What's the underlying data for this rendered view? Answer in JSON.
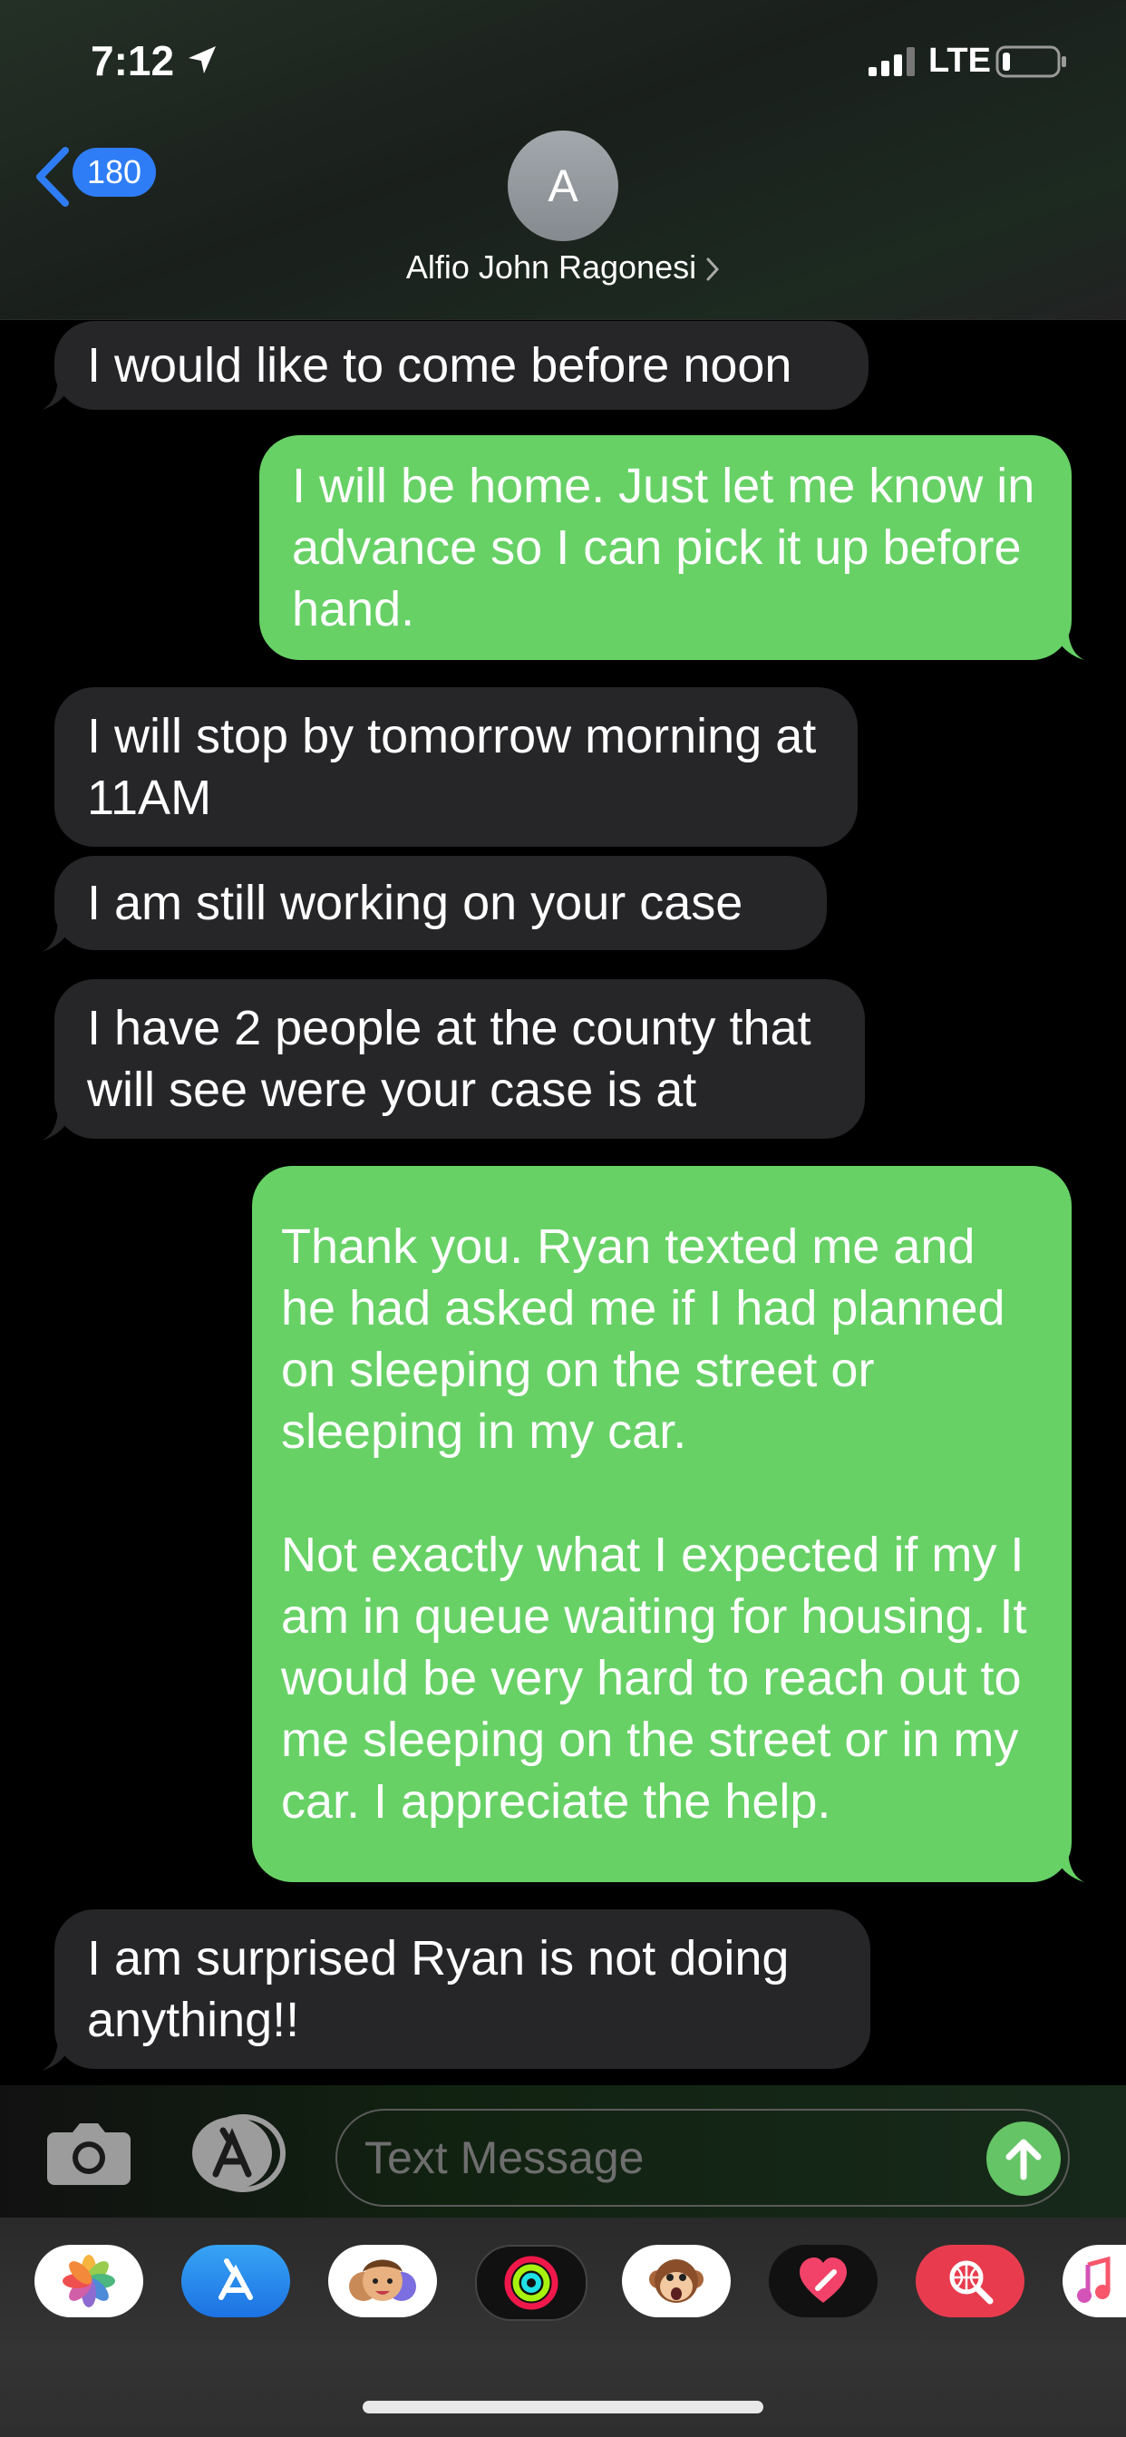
{
  "status_bar": {
    "time": "7:12",
    "network": "LTE"
  },
  "nav": {
    "back_count": "180",
    "avatar_initial": "A",
    "contact_name": "Alfio John Ragonesi"
  },
  "messages": [
    {
      "direction": "incoming",
      "text": "I would like to come before noon"
    },
    {
      "direction": "outgoing",
      "text": "I will be home. Just let me know in advance so I can pick it up before hand."
    },
    {
      "direction": "incoming",
      "text": "I will stop by tomorrow morning at 11AM"
    },
    {
      "direction": "incoming",
      "text": "I am still working on your case"
    },
    {
      "direction": "incoming",
      "text": "I have 2 people at the county that will see were your case is at"
    },
    {
      "direction": "outgoing",
      "text": "Thank you. Ryan texted me and he had asked me if I had planned on sleeping on the street or sleeping in my car.\n\nNot exactly what I expected if my I am in queue waiting for housing. It would be very hard to reach out to me sleeping on the street or in my car. I appreciate the help."
    },
    {
      "direction": "incoming",
      "text": "I am surprised Ryan is not doing anything!!"
    }
  ],
  "composer": {
    "placeholder": "Text Message"
  },
  "app_drawer": [
    "photos-icon",
    "app-store-icon",
    "memoji-icon",
    "activity-icon",
    "animoji-icon",
    "digital-touch-icon",
    "image-search-icon",
    "music-icon"
  ],
  "colors": {
    "incoming_bubble": "#262628",
    "outgoing_bubble": "#67d166",
    "badge": "#2f7df6"
  }
}
